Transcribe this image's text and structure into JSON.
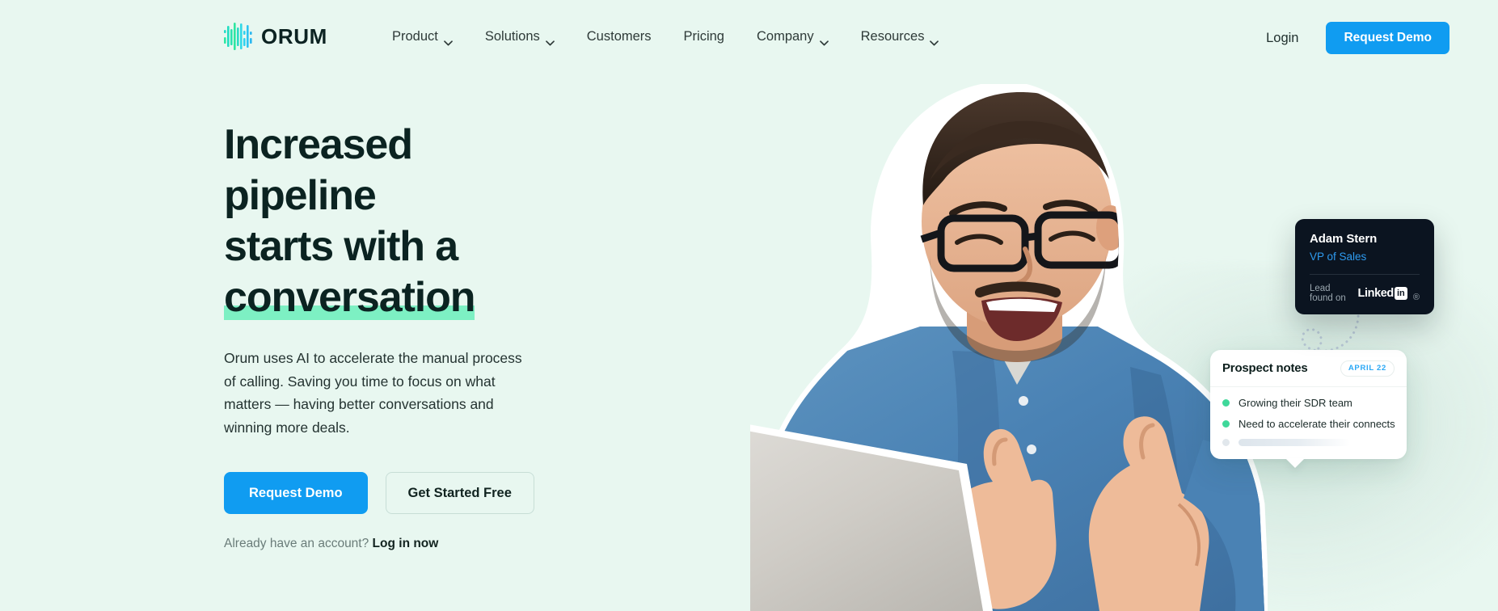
{
  "brand": {
    "name": "ORUM",
    "logo_icon": "orum-waveform-logo",
    "logo_colors": [
      "#19d3c5",
      "#2ee6a8",
      "#35d6f0",
      "#2bb8f0"
    ]
  },
  "header": {
    "nav_items": [
      {
        "label": "Product",
        "has_dropdown": true
      },
      {
        "label": "Solutions",
        "has_dropdown": true
      },
      {
        "label": "Customers",
        "has_dropdown": false
      },
      {
        "label": "Pricing",
        "has_dropdown": false
      },
      {
        "label": "Company",
        "has_dropdown": true
      },
      {
        "label": "Resources",
        "has_dropdown": true
      }
    ],
    "login_label": "Login",
    "demo_button_label": "Request Demo"
  },
  "hero": {
    "title_line1": "Increased pipeline",
    "title_line2": "starts with a",
    "title_line3_highlighted": "conversation",
    "highlight_color": "#7df0c3",
    "subtitle": "Orum uses AI to accelerate the manual process of calling. Saving you time to focus on what matters — having better conversations and winning more deals.",
    "primary_cta": "Request Demo",
    "secondary_cta": "Get Started Free",
    "account_prefix": "Already have an account?",
    "account_link": "Log in now"
  },
  "lead_card": {
    "name": "Adam Stern",
    "role": "VP of Sales",
    "found_label": "Lead found on",
    "source_word": "Linked",
    "source_box": "in",
    "source_suffix": "®",
    "role_color": "#2e9bf0",
    "background_color": "#0b1420"
  },
  "notes_card": {
    "title": "Prospect notes",
    "date_badge": "APRIL 22",
    "badge_color": "#2aa8f5",
    "notes": [
      "Growing their SDR team",
      "Need to accelerate their connects"
    ],
    "placeholder_row": ""
  },
  "theme": {
    "page_background": "#e8f7f0",
    "accent_blue": "#109cf1",
    "accent_green": "#3fd89a",
    "heading_color": "#0b2321"
  }
}
